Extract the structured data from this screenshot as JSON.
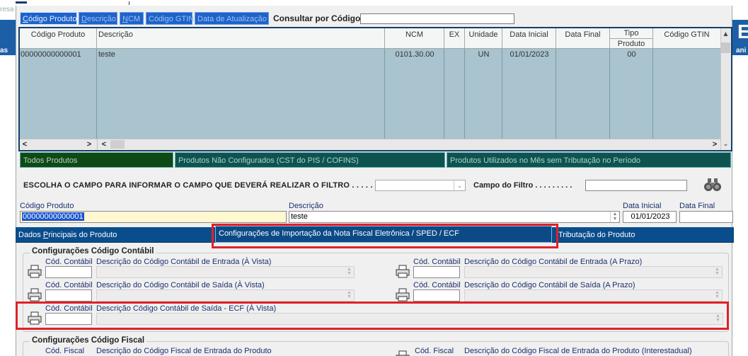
{
  "background": {
    "left_fragment": "resa",
    "left_label": "as",
    "right_label": "ani",
    "right_glyph": "E"
  },
  "search_tabs": [
    {
      "label_pre": "",
      "label_u": "C",
      "label_post": "ódigo Produto",
      "active": true
    },
    {
      "label_pre": "",
      "label_u": "D",
      "label_post": "escrição",
      "active": false
    },
    {
      "label_pre": "",
      "label_u": "N",
      "label_post": "CM",
      "active": false
    },
    {
      "label_pre": "Código GTIN",
      "label_u": "",
      "label_post": "",
      "active": false
    },
    {
      "label_pre": "Data de Atualização",
      "label_u": "",
      "label_post": "",
      "active": false
    }
  ],
  "consult": {
    "label": "Consultar por Código:",
    "value": ""
  },
  "grid": {
    "columns": [
      "Código Produto",
      "Descrição",
      "NCM",
      "EX",
      "Unidade",
      "Data Inicial",
      "Data Final",
      "Tipo",
      "Produto",
      "Código GTIN"
    ],
    "row": {
      "codigo": "00000000000001",
      "descricao": "teste",
      "ncm": "0101.30.00",
      "ex": "",
      "unidade": "UN",
      "data_inicial": "01/01/2023",
      "data_final": "",
      "tipo_produto": "00",
      "gtin": ""
    },
    "scroll_left": "<",
    "scroll_right": ">",
    "scroll_up": "▲",
    "scroll_down": "⌄"
  },
  "filter_tabs": [
    {
      "label": "Todos Produtos",
      "bg": "#0f4a14"
    },
    {
      "label": "Produtos Não Configurados (CST do PIS / COFINS)",
      "bg": "#0d5451"
    },
    {
      "label": "Produtos Utilizados no Mês sem Tributação no Período",
      "bg": "#0d5451"
    }
  ],
  "filter": {
    "label": "ESCOLHA O CAMPO PARA INFORMAR O CAMPO QUE DEVERÁ REALIZAR O FILTRO . . . . . . . . . :",
    "campo_label": "Campo do Filtro . . . . . . . . ."
  },
  "product": {
    "codigo_label": "Código Produto",
    "codigo_value": "00000000000001",
    "descricao_label": "Descrição",
    "descricao_value": "teste",
    "data_inicial_label": "Data Inicial",
    "data_inicial_value": "01/01/2023",
    "data_final_label": "Data Final",
    "data_final_value": ""
  },
  "section_tabs": {
    "dados_pre": "Dados ",
    "dados_u": "P",
    "dados_post": "rincipais do Produto",
    "config": "Configurações de Importação da Nota Fiscal Eletrônica / SPED / ECF",
    "trib": "Tributação do Produto"
  },
  "contabil": {
    "title": "Configurações Código Contábil",
    "cod_label": "Cód. Contábil",
    "entrada_vista": "Descrição do Código Contábil de Entrada (À Vista)",
    "entrada_prazo": "Descrição do Código Contábil de Entrada (A Prazo)",
    "saida_vista": "Descrição do Código Contábil de Saída (À Vista)",
    "saida_prazo": "Descrição do Código Contábil de Saída (A Prazo)",
    "saida_ecf": "Descrição Código Contábil de Saída  -  ECF (À Vista)"
  },
  "fiscal": {
    "title": "Configurações Código Fiscal",
    "cod_label": "Cód. Fiscal",
    "entrada": "Descrição do Código Fiscal de Entrada do Produto",
    "entrada_inter": "Descrição do Código Fiscal de Entrada do Produto (Interestadual)"
  },
  "colors": {
    "highlight": "#e02028",
    "tab_blue": "#1e63c9",
    "section_blue": "#0a4d8c",
    "grid_row": "#a9c3cf"
  }
}
